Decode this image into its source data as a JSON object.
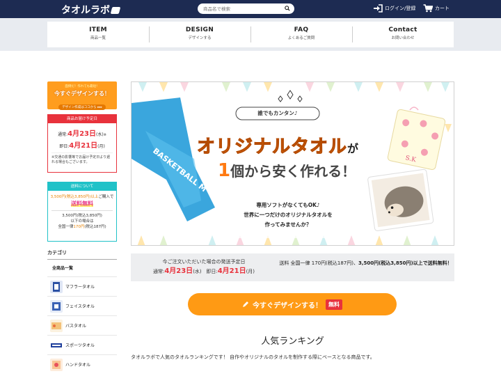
{
  "header": {
    "logo_text": "タオルラボ",
    "search": {
      "placeholder": "商品名で検索",
      "icon": "search-icon"
    },
    "login_label": "ログイン/登録",
    "cart_label": "カート"
  },
  "nav": [
    {
      "main": "ITEM",
      "sub": "商品一覧"
    },
    {
      "main": "DESIGN",
      "sub": "デザインする"
    },
    {
      "main": "FAQ",
      "sub": "よくあるご質問"
    },
    {
      "main": "Contact",
      "sub": "お問い合わせ"
    }
  ],
  "sidebar": {
    "banner": {
      "top": "面倒だ！作れても最短！",
      "main": "今すぐデザインする！",
      "sub": "デザイン作成はココから ▸▸▸"
    },
    "shipping": {
      "head": "商品お届け予定日",
      "normal_label": "通常:",
      "normal_date": "4月23日",
      "normal_day": "(水)",
      "normal_suffix": "※",
      "express_label": "即日:",
      "express_date": "4月21日",
      "express_day": "(月)",
      "note": "※交通の影響等でお届け予定日より遅れる場合もございます。"
    },
    "fee": {
      "head": "送料について",
      "l1_price": "3,500円(税込3,850円)以上",
      "l1_rest": "ご購入で",
      "free": "送料無料",
      "l2_a": "3,500円(税込3,850円)",
      "l2_b": "以下の場合は",
      "l2_c_pre": "全国一律",
      "l2_c_price": "170円",
      "l2_c_post": "(税込187円)"
    },
    "category_title": "カテゴリ",
    "category_all": "全商品一覧",
    "categories": [
      "マフラータオル",
      "フェイスタオル",
      "バスタオル",
      "スポーツタオル",
      "ハンドタオル"
    ]
  },
  "hero": {
    "tag": "誰でもカンタン♪",
    "title": "オリジナルタオル",
    "title_particle": "が",
    "sub_num": "1",
    "sub_rest": "個から安く作れる！",
    "body_lines": [
      "専用ソフトがなくてもOK♪",
      "世界に一つだけのオリジナルタオルを",
      "作ってみませんか？"
    ],
    "towel_text": "BASKETBALL M",
    "initials": "S.K"
  },
  "info": {
    "left_line1": "今ご注文いただいた場合の発送予定日",
    "normal_label": "通常:",
    "normal_date": "4月23日",
    "normal_day": "(水)",
    "express_label": "即日:",
    "express_date": "4月21日",
    "express_day": "(月)",
    "right_pre": "送料 全国一律 170円(税込187円)、",
    "right_bold": "3,500円(税込3,850円)以上で送料無料！"
  },
  "cta": {
    "label": "今すぐデザインする！",
    "badge": "無料"
  },
  "ranking": {
    "title": "人気ランキング",
    "desc": "タオルラボで人気のタオルランキングです！ 自作やオリジナルのタオルを制作する際にベースとなる商品です。"
  },
  "colors": {
    "header_bg": "#1d2b52",
    "accent_orange": "#ff9a14",
    "accent_red": "#e8323c",
    "accent_teal": "#20c2c8",
    "free_pink": "#e83c8c"
  }
}
